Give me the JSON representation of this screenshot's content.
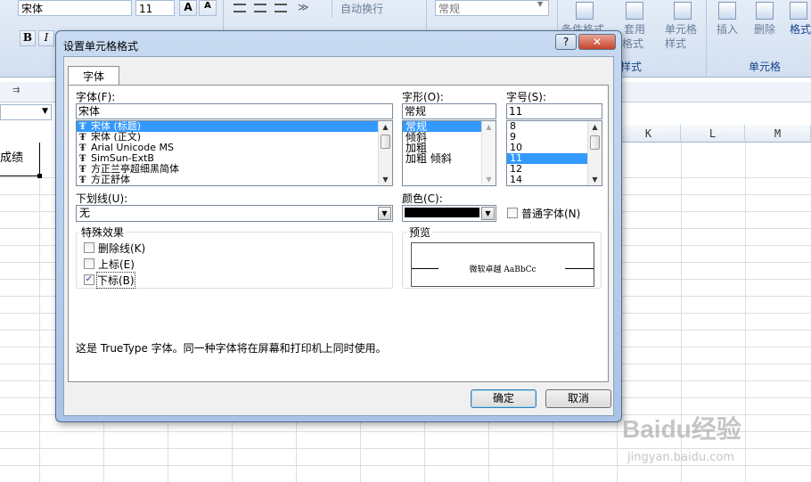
{
  "ribbon": {
    "font_name": "宋体",
    "font_size": "11",
    "grow_font": "A",
    "shrink_font": "A",
    "bold": "B",
    "italic": "I",
    "wrap_text": "自动换行",
    "number_format": "常规",
    "cond_format": "条件格式",
    "table_format_line1": "套用",
    "table_format_line2": "格式",
    "cell_style_line1": "单元格",
    "cell_style_line2": "样式",
    "insert": "插入",
    "delete": "删除",
    "format": "格式",
    "styles_group": "样式",
    "cells_group": "单元格"
  },
  "sheet": {
    "col_headers": [
      "K",
      "L",
      "M"
    ],
    "cell_text": "成绩"
  },
  "dialog": {
    "title": "设置单元格格式",
    "help": "?",
    "close": "✕",
    "tab_font": "字体",
    "font_label": "字体(F):",
    "font_value": "宋体",
    "font_list": [
      "宋体 (标题)",
      "宋体 (正文)",
      "Arial Unicode MS",
      "SimSun-ExtB",
      "方正兰亭超细黑简体",
      "方正舒体"
    ],
    "style_label": "字形(O):",
    "style_value": "常规",
    "style_list": [
      "常规",
      "倾斜",
      "加粗",
      "加粗 倾斜"
    ],
    "size_label": "字号(S):",
    "size_value": "11",
    "size_list": [
      "8",
      "9",
      "10",
      "11",
      "12",
      "14"
    ],
    "underline_label": "下划线(U):",
    "underline_value": "无",
    "color_label": "颜色(C):",
    "color_value": "#000000",
    "normal_font": "普通字体(N)",
    "effects_label": "特殊效果",
    "strike": "删除线(K)",
    "superscript": "上标(E)",
    "subscript": "下标(B)",
    "preview_label": "预览",
    "preview_text": "微软卓越 AaBbCc",
    "info_text": "这是 TrueType 字体。同一种字体将在屏幕和打印机上同时使用。",
    "ok": "确定",
    "cancel": "取消"
  },
  "watermark": {
    "brand": "Baidu经验",
    "url": "jingyan.baidu.com"
  }
}
